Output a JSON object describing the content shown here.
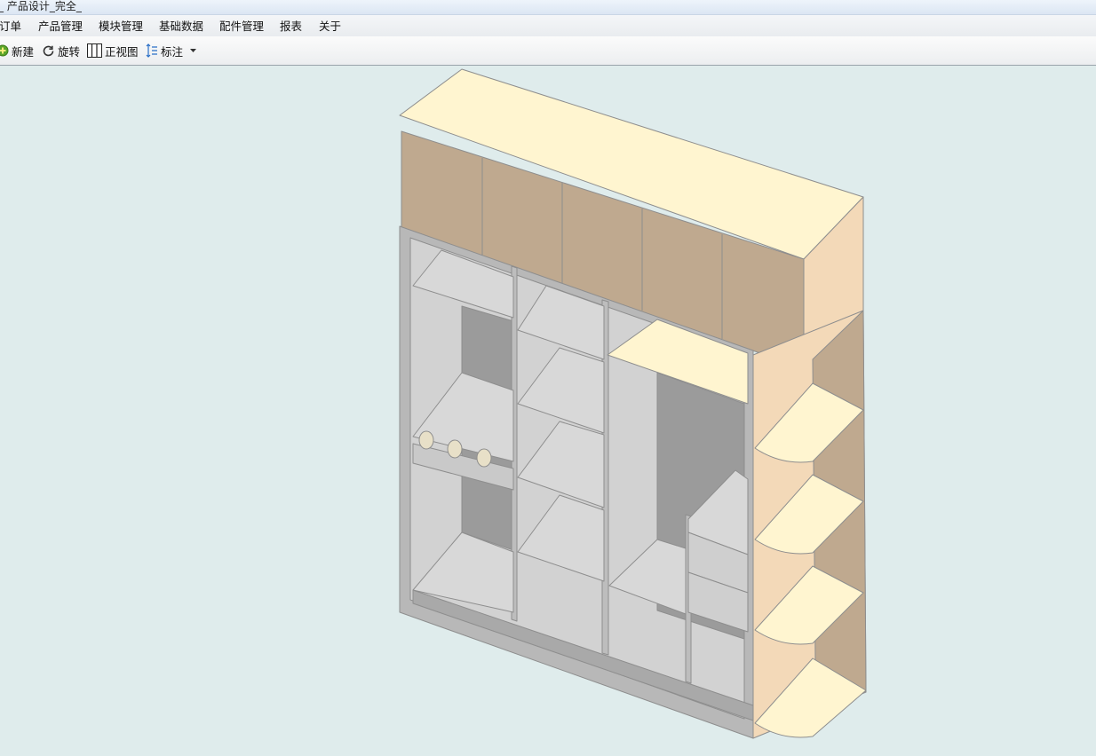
{
  "window": {
    "title": "_ 产品设计_完全_"
  },
  "menu": {
    "items": [
      {
        "label": "订单"
      },
      {
        "label": "产品管理"
      },
      {
        "label": "模块管理"
      },
      {
        "label": "基础数据"
      },
      {
        "label": "配件管理"
      },
      {
        "label": "报表"
      },
      {
        "label": "关于"
      }
    ]
  },
  "toolbar": {
    "new_label": "新建",
    "rotate_label": "旋转",
    "front_view_label": "正视图",
    "annotate_label": "标注",
    "icons": {
      "new": "plus-circle-icon",
      "rotate": "rotate-icon",
      "front_view": "grid-columns-icon",
      "annotate": "dimension-icon",
      "dropdown": "caret-down-icon"
    }
  },
  "viewport": {
    "model": "wardrobe-3d-model",
    "colors": {
      "background": "#dfecec",
      "top_cabinet_doors": "#bfa98f",
      "maple_panel": "#f3d9b8",
      "cream_shelf": "#fff5d0",
      "interior_gray": "#d6d6d6",
      "interior_dark": "#9b9b9b",
      "frame_gray": "#b8b8b8"
    }
  }
}
